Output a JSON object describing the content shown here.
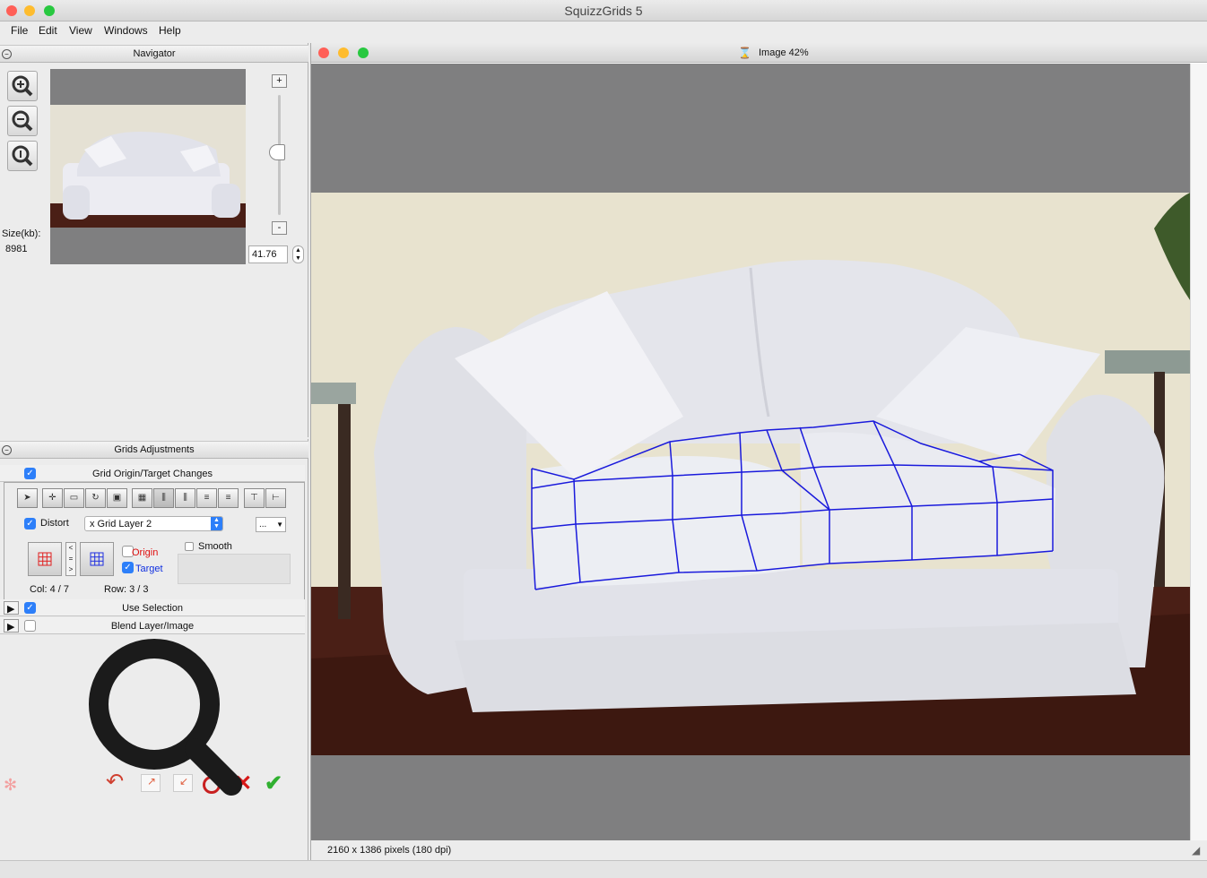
{
  "window": {
    "title": "SquizzGrids 5"
  },
  "menu": {
    "items": [
      "File",
      "Edit",
      "View",
      "Windows",
      "Help"
    ]
  },
  "navigator": {
    "title": "Navigator",
    "size_label": "Size(kb):",
    "size_value": "8981",
    "zoom_value": "41.76",
    "zoom_plus": "+",
    "zoom_minus": "-"
  },
  "grids": {
    "title": "Grids Adjustments",
    "origin_target_label": "Grid Origin/Target Changes",
    "distort_label": "Distort",
    "layer_select": "x Grid Layer 2",
    "more_button": "...",
    "origin_label": "Origin",
    "target_label": "Target",
    "smooth_label": "Smooth",
    "col_label": "Col: 4 / 7",
    "row_label": "Row: 3 / 3",
    "use_selection_label": "Use Selection",
    "blend_label": "Blend Layer/Image"
  },
  "image_window": {
    "title": "Image 42%",
    "status": "2160 x 1386 pixels (180 dpi)"
  },
  "colors": {
    "accent": "#2d7ff9",
    "grid_line": "#1a1adc",
    "origin_text": "#e01010",
    "target_text": "#1030e0"
  }
}
